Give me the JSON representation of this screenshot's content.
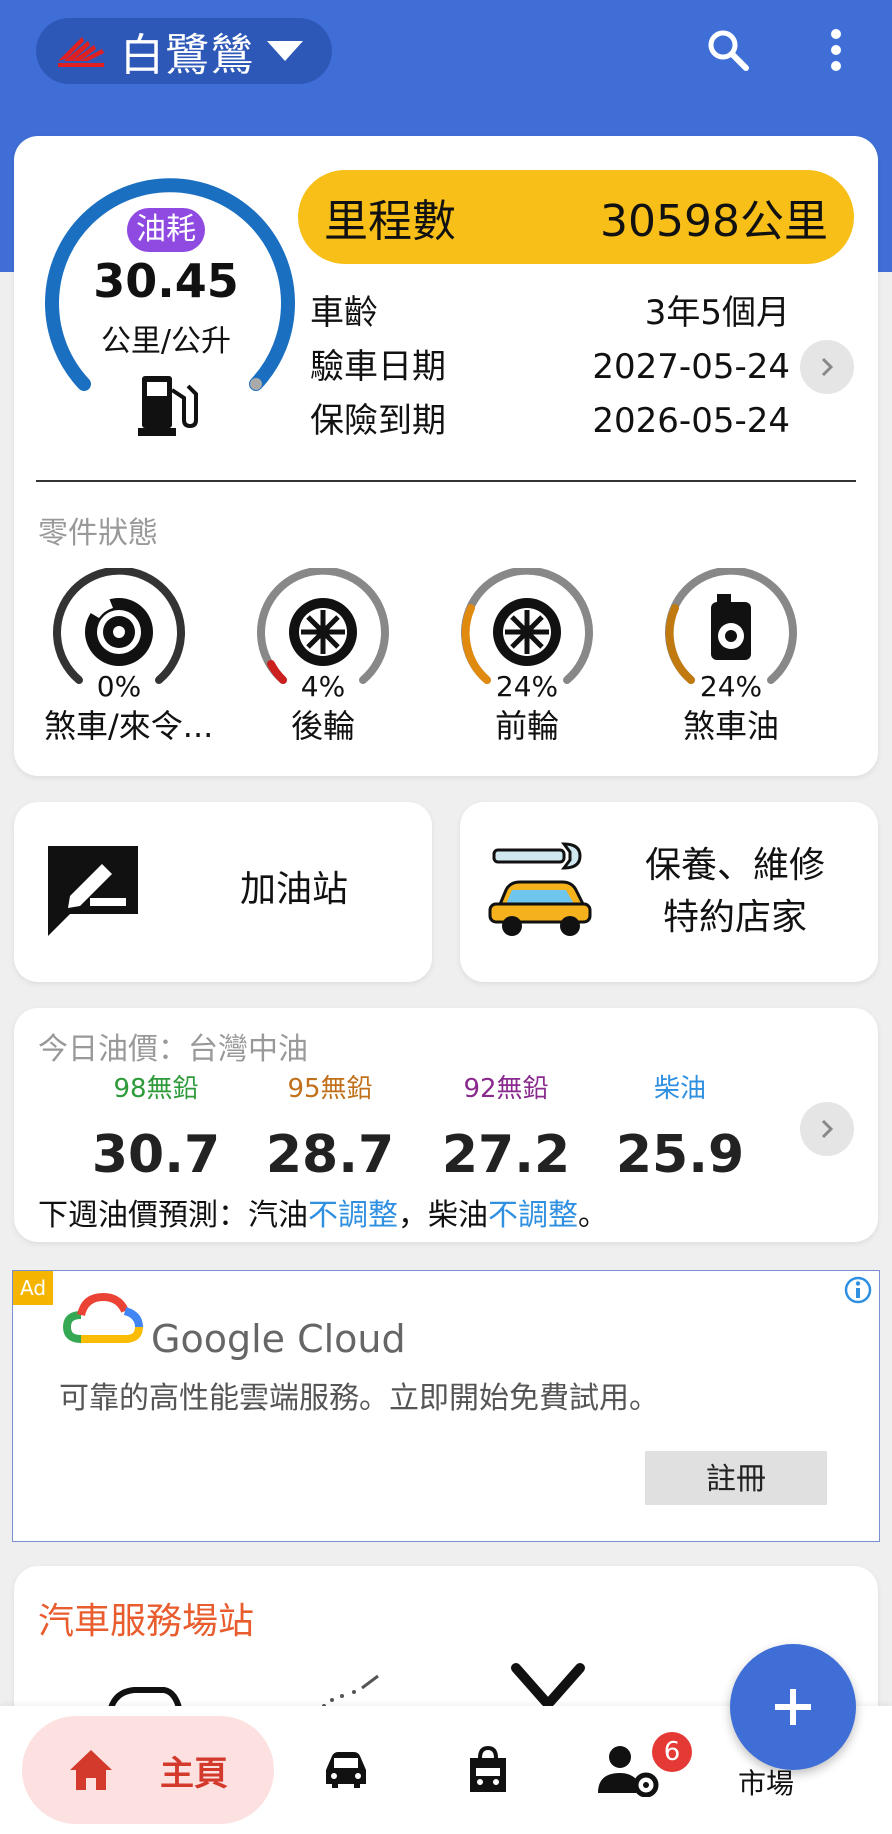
{
  "app": {
    "title": "白鷺鷥",
    "brand_color": "#3f6fd6"
  },
  "summary": {
    "fuel_label": "油耗",
    "fuel_value": "30.45",
    "fuel_unit": "公里/公升",
    "odometer_label": "里程數",
    "odometer_value": "30598公里",
    "rows": [
      {
        "label": "車齡",
        "value": "3年5個月"
      },
      {
        "label": "驗車日期",
        "value": "2027-05-24"
      },
      {
        "label": "保險到期",
        "value": "2026-05-24"
      }
    ],
    "parts_title": "零件狀態",
    "parts": [
      {
        "pct": "0%",
        "name": "煞車/來令...",
        "level": 0
      },
      {
        "pct": "4%",
        "name": "後輪",
        "level": 4
      },
      {
        "pct": "24%",
        "name": "前輪",
        "level": 24
      },
      {
        "pct": "24%",
        "name": "煞車油",
        "level": 24
      }
    ]
  },
  "quick": {
    "gas_station": "加油站",
    "service_line1": "保養、維修",
    "service_line2": "特約店家"
  },
  "oil": {
    "title": "今日油價：台灣中油",
    "fuels": [
      {
        "name": "98無鉛",
        "price": "30.7",
        "color": "#2e9a3a"
      },
      {
        "name": "95無鉛",
        "price": "28.7",
        "color": "#c0701a"
      },
      {
        "name": "92無鉛",
        "price": "27.2",
        "color": "#8a2a8e"
      },
      {
        "name": "柴油",
        "price": "25.9",
        "color": "#2f8fe0"
      }
    ],
    "forecast_prefix": "下週油價預測：汽油",
    "forecast_gas": "不調整",
    "forecast_mid": "，柴油",
    "forecast_diesel": "不調整",
    "forecast_end": "。"
  },
  "ad": {
    "tag": "Ad",
    "brand": "Google Cloud",
    "text": "可靠的高性能雲端服務。立即開始免費試用。",
    "button": "註冊"
  },
  "services": {
    "title": "汽車服務場站"
  },
  "nav": {
    "home": "主頁",
    "badge": "6",
    "last_label": "市場"
  }
}
